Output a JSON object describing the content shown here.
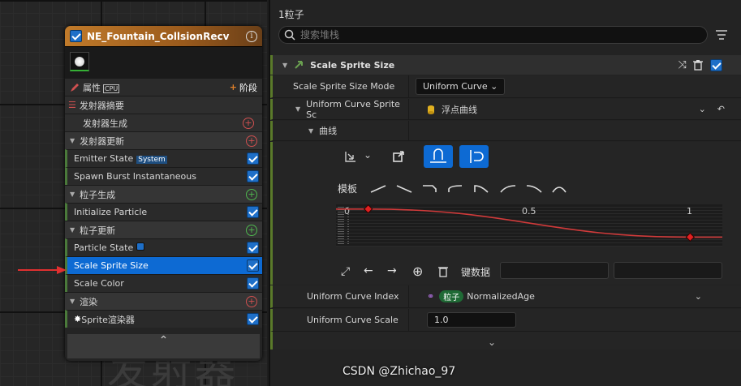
{
  "node": {
    "title": "NE_Fountain_CollsionRecv",
    "info_glyph": "i",
    "attributes": "属性",
    "cpu": "CPU",
    "stage": "阶段",
    "rows": [
      {
        "kind": "sub",
        "label": "发射器摘要"
      },
      {
        "kind": "sub",
        "label": "发射器生成"
      },
      {
        "kind": "sec",
        "label": "发射器更新"
      },
      {
        "kind": "mod",
        "label": "Emitter State",
        "tag": "System"
      },
      {
        "kind": "mod",
        "label": "Spawn Burst Instantaneous"
      },
      {
        "kind": "sec",
        "label": "粒子生成"
      },
      {
        "kind": "mod",
        "label": "Initialize Particle"
      },
      {
        "kind": "sec",
        "label": "粒子更新"
      },
      {
        "kind": "mod",
        "label": "Particle State"
      },
      {
        "kind": "mod",
        "label": "Scale Sprite Size",
        "selected": true
      },
      {
        "kind": "mod",
        "label": "Scale Color"
      },
      {
        "kind": "sec",
        "label": "渲染"
      },
      {
        "kind": "mod",
        "label": "Sprite渲染器"
      }
    ],
    "watermark": "发射器"
  },
  "panel": {
    "title": "1粒子",
    "search_placeholder": "搜索堆栈",
    "module_title": "Scale Sprite Size",
    "mode_label": "Scale Sprite Size Mode",
    "mode_value": "Uniform Curve",
    "curve_label": "Uniform Curve Sprite Sc",
    "curve_value": "浮点曲线",
    "curve_sub": "曲线",
    "template_label": "模板",
    "axis_ticks": [
      "0",
      "0.5",
      "1"
    ],
    "key_label": "键数据",
    "index_label": "Uniform Curve Index",
    "index_pill": "粒子",
    "index_value": "NormalizedAge",
    "scale_label": "Uniform Curve Scale",
    "scale_value": "1.0"
  },
  "chart_data": {
    "type": "line",
    "x": [
      0,
      1
    ],
    "y": [
      1,
      0.7
    ],
    "xlim": [
      -0.1,
      1.1
    ],
    "x_ticks": [
      "0",
      "0.5",
      "1"
    ],
    "line_color": "#d03a3a"
  },
  "watermark": "CSDN @Zhichao_97",
  "colors": {
    "accent": "#0d6ad3",
    "module_green": "#5a7a2a",
    "header_orange": "#c07a2a"
  }
}
